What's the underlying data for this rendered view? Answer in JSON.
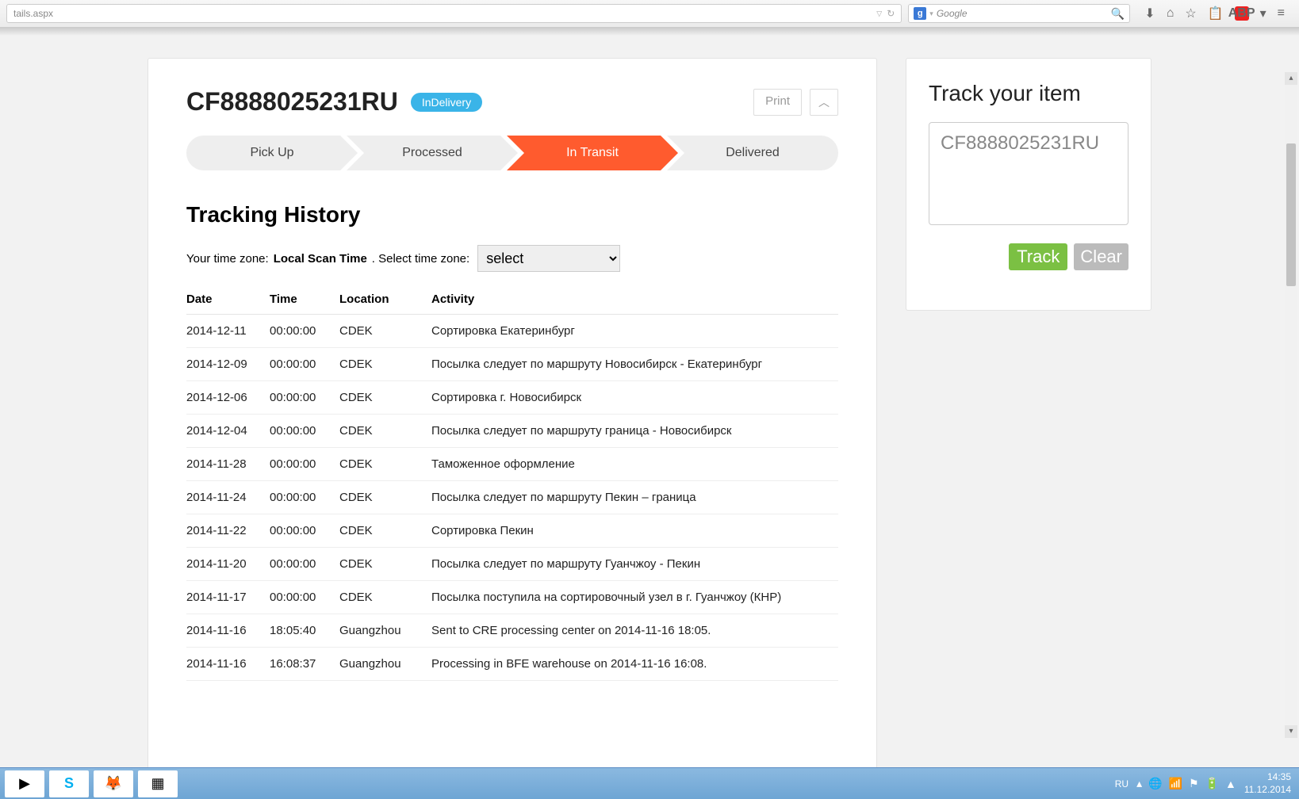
{
  "browser": {
    "url_fragment": "tails.aspx",
    "search_provider_label": "g",
    "search_placeholder": "Google"
  },
  "header": {
    "tracking_number": "CF8888025231RU",
    "status_badge": "InDelivery",
    "print_label": "Print"
  },
  "steps": [
    {
      "label": "Pick Up",
      "active": false
    },
    {
      "label": "Processed",
      "active": false
    },
    {
      "label": "In Transit",
      "active": true
    },
    {
      "label": "Delivered",
      "active": false
    }
  ],
  "history": {
    "title": "Tracking History",
    "tz_prefix": "Your time zone:",
    "tz_value": "Local Scan Time",
    "tz_select_label": ". Select time zone:",
    "tz_select_placeholder": "select",
    "columns": {
      "date": "Date",
      "time": "Time",
      "location": "Location",
      "activity": "Activity"
    },
    "rows": [
      {
        "date": "2014-12-11",
        "time": "00:00:00",
        "location": "CDEK",
        "activity": "Сортировка Екатеринбург"
      },
      {
        "date": "2014-12-09",
        "time": "00:00:00",
        "location": "CDEK",
        "activity": "Посылка следует по маршруту Новосибирск - Екатеринбург"
      },
      {
        "date": "2014-12-06",
        "time": "00:00:00",
        "location": "CDEK",
        "activity": "Сортировка г. Новосибирск"
      },
      {
        "date": "2014-12-04",
        "time": "00:00:00",
        "location": "CDEK",
        "activity": "Посылка следует по маршруту граница - Новосибирск"
      },
      {
        "date": "2014-11-28",
        "time": "00:00:00",
        "location": "CDEK",
        "activity": "Таможенное оформление"
      },
      {
        "date": "2014-11-24",
        "time": "00:00:00",
        "location": "CDEK",
        "activity": "Посылка следует по маршруту Пекин – граница"
      },
      {
        "date": "2014-11-22",
        "time": "00:00:00",
        "location": "CDEK",
        "activity": "Сортировка Пекин"
      },
      {
        "date": "2014-11-20",
        "time": "00:00:00",
        "location": "CDEK",
        "activity": "Посылка следует по маршруту Гуанчжоу - Пекин"
      },
      {
        "date": "2014-11-17",
        "time": "00:00:00",
        "location": "CDEK",
        "activity": "Посылка поступила на сортировочный узел в г. Гуанчжоу (КНР)"
      },
      {
        "date": "2014-11-16",
        "time": "18:05:40",
        "location": "Guangzhou",
        "activity": "Sent to CRE processing center on 2014-11-16 18:05."
      },
      {
        "date": "2014-11-16",
        "time": "16:08:37",
        "location": "Guangzhou",
        "activity": "Processing in BFE warehouse on 2014-11-16 16:08."
      }
    ]
  },
  "sidebar": {
    "title": "Track your item",
    "input_value": "CF8888025231RU",
    "track_label": "Track",
    "clear_label": "Clear"
  },
  "taskbar": {
    "lang": "RU",
    "time": "14:35",
    "date": "11.12.2014"
  }
}
